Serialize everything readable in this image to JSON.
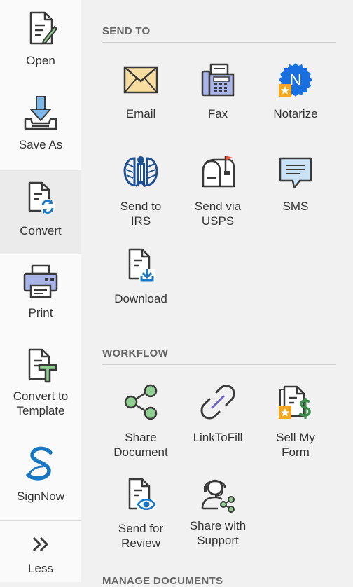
{
  "sidebar": {
    "items": [
      {
        "label": "Open",
        "icon": "document-edit-icon"
      },
      {
        "label": "Save As",
        "icon": "download-tray-icon"
      },
      {
        "label": "Convert",
        "icon": "document-convert-icon"
      },
      {
        "label": "Print",
        "icon": "printer-icon"
      },
      {
        "label": "Convert to\nTemplate",
        "icon": "document-template-icon"
      },
      {
        "label": "SignNow",
        "icon": "signnow-logo-icon"
      },
      {
        "label": "Less",
        "icon": "double-chevron-icon"
      }
    ],
    "active_index": 2
  },
  "sections": {
    "send_to": {
      "title": "SEND TO",
      "items": [
        {
          "label": "Email",
          "icon": "envelope-icon"
        },
        {
          "label": "Fax",
          "icon": "fax-icon"
        },
        {
          "label": "Notarize",
          "icon": "notary-badge-icon"
        },
        {
          "label": "Send to\nIRS",
          "icon": "irs-eagle-icon"
        },
        {
          "label": "Send via\nUSPS",
          "icon": "mailbox-icon"
        },
        {
          "label": "SMS",
          "icon": "chat-bubble-icon"
        },
        {
          "label": "Download",
          "icon": "document-download-icon"
        }
      ]
    },
    "workflow": {
      "title": "WORKFLOW",
      "items": [
        {
          "label": "Share\nDocument",
          "icon": "share-icon"
        },
        {
          "label": "LinkToFill",
          "icon": "link-icon"
        },
        {
          "label": "Sell My\nForm",
          "icon": "sell-form-icon"
        },
        {
          "label": "Send for\nReview",
          "icon": "document-review-icon"
        },
        {
          "label": "Share with\nSupport",
          "icon": "support-agent-icon"
        }
      ]
    },
    "manage": {
      "title": "MANAGE DOCUMENTS"
    }
  },
  "colors": {
    "accent_blue": "#1a78c2",
    "green": "#8fcf8f",
    "orange": "#f5a623",
    "icon_dark": "#3a3a3a"
  }
}
